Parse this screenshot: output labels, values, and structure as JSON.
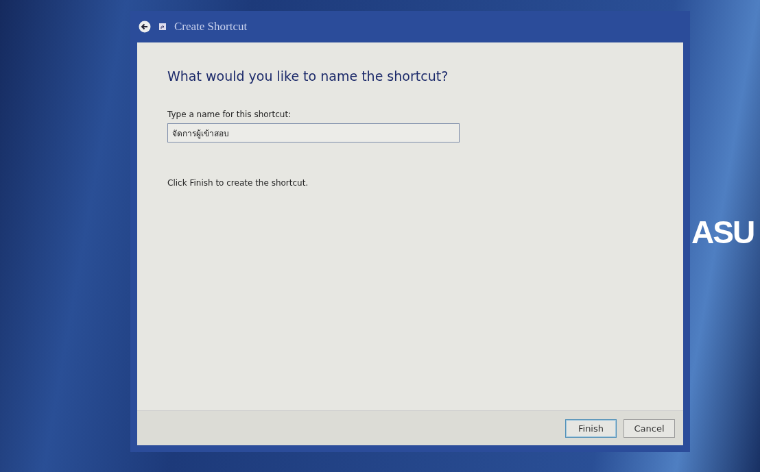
{
  "window": {
    "title": "Create Shortcut"
  },
  "heading": "What would you like to name the shortcut?",
  "name_field": {
    "label": "Type a name for this shortcut:",
    "value": "จัดการผู้เข้าสอบ"
  },
  "instruction": "Click Finish to create the shortcut.",
  "buttons": [
    {
      "label": "Finish",
      "default": true
    },
    {
      "label": "Cancel",
      "default": false
    }
  ],
  "desktop_logo": "ASU"
}
